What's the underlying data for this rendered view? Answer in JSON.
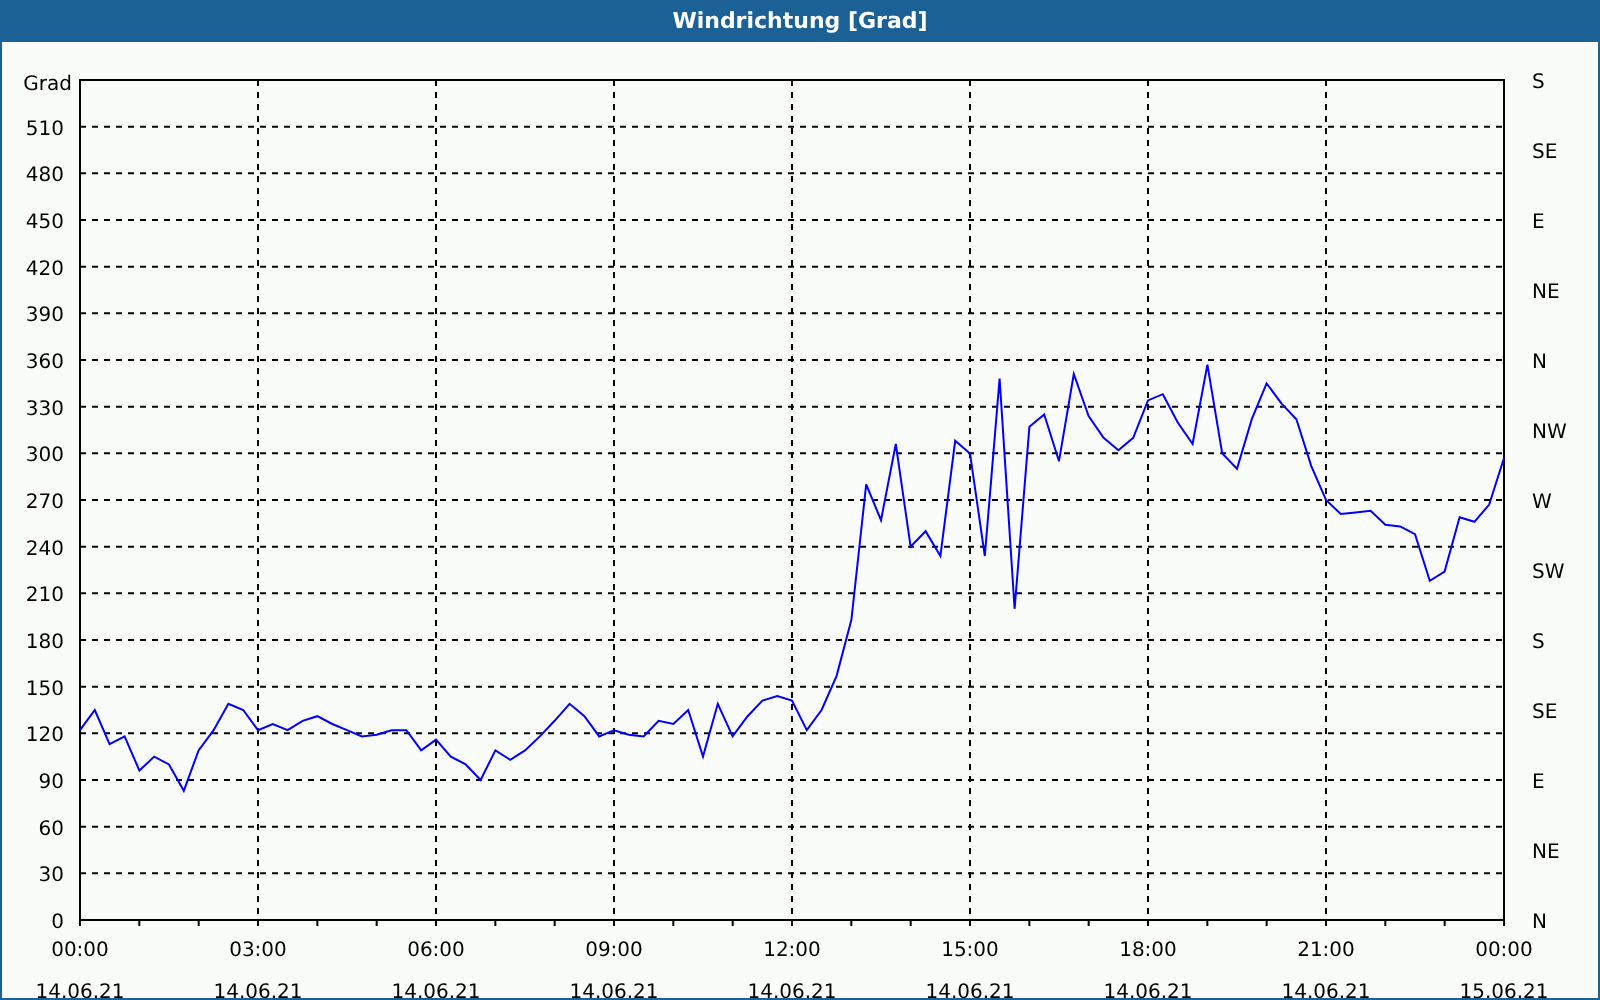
{
  "window": {
    "title": "Windrichtung [Grad]"
  },
  "chart_data": {
    "type": "line",
    "ylabel": "Grad",
    "grid": true,
    "ylim": [
      0,
      540
    ],
    "yticks": [
      0,
      30,
      60,
      90,
      120,
      150,
      180,
      210,
      240,
      270,
      300,
      330,
      360,
      390,
      420,
      450,
      480,
      510
    ],
    "categories": [
      "00:00\n14.06.21",
      null,
      null,
      null,
      null,
      null,
      null,
      null,
      null,
      null,
      null,
      null,
      "03:00\n14.06.21",
      null,
      null,
      null,
      null,
      null,
      null,
      null,
      null,
      null,
      null,
      null,
      "06:00\n14.06.21",
      null,
      null,
      null,
      null,
      null,
      null,
      null,
      null,
      null,
      null,
      null,
      "09:00\n14.06.21",
      null,
      null,
      null,
      null,
      null,
      null,
      null,
      null,
      null,
      null,
      null,
      "12:00\n14.06.21",
      null,
      null,
      null,
      null,
      null,
      null,
      null,
      null,
      null,
      null,
      null,
      "15:00\n14.06.21",
      null,
      null,
      null,
      null,
      null,
      null,
      null,
      null,
      null,
      null,
      null,
      "18:00\n14.06.21",
      null,
      null,
      null,
      null,
      null,
      null,
      null,
      null,
      null,
      null,
      null,
      "21:00\n14.06.21",
      null,
      null,
      null,
      null,
      null,
      null,
      null,
      null,
      null,
      null,
      null,
      "00:00\n15.06.21"
    ],
    "series": [
      {
        "color": "#0000ff",
        "values": [
          122,
          135,
          113,
          118,
          96,
          105,
          100,
          83,
          109,
          122,
          139,
          135,
          122,
          126,
          122,
          128,
          131,
          126,
          122,
          118,
          119,
          122,
          122,
          109,
          116,
          105,
          100,
          90,
          109,
          103,
          109,
          118,
          128,
          139,
          131,
          118,
          122,
          119,
          118,
          128,
          126,
          135,
          105,
          139,
          118,
          131,
          141,
          144,
          141,
          122,
          135,
          157,
          193,
          280,
          257,
          306,
          240,
          250,
          234,
          308,
          300,
          234,
          348,
          200,
          317,
          325,
          295,
          351,
          324,
          310,
          302,
          310,
          334,
          338,
          320,
          306,
          357,
          300,
          290,
          322,
          345,
          332,
          322,
          292,
          270,
          261,
          262,
          263,
          254,
          253,
          248,
          218,
          224,
          259,
          256,
          267,
          297
        ]
      }
    ]
  },
  "right_axis": {
    "labels": [
      "S",
      "SE",
      "E",
      "NE",
      "N",
      "NW",
      "W",
      "SW",
      "S",
      "SE",
      "E",
      "NE",
      "N"
    ]
  }
}
